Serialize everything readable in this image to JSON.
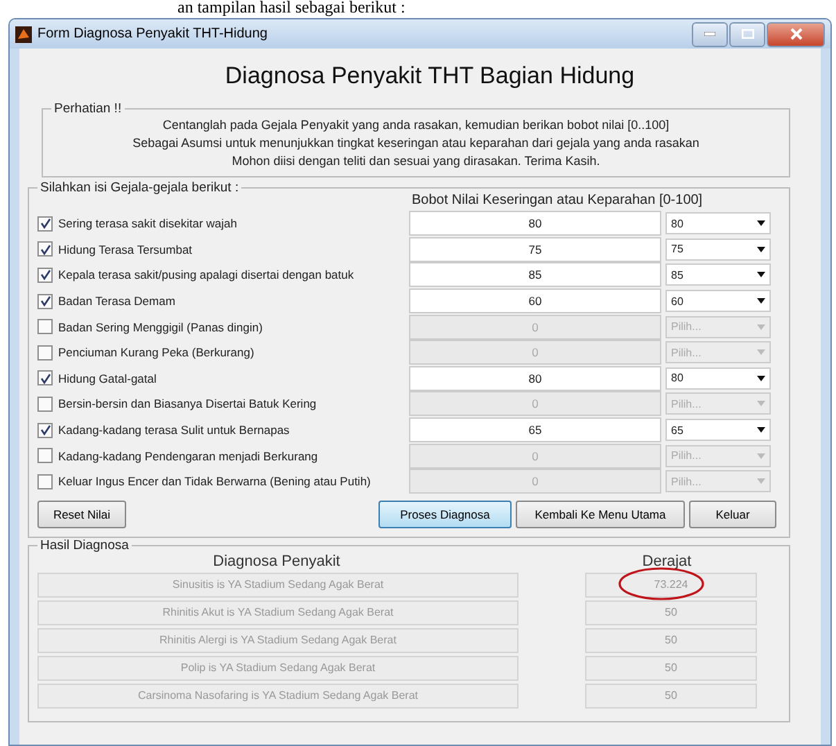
{
  "caption": "an tampilan hasil sebagai berikut :",
  "window": {
    "title": "Form Diagnosa Penyakit THT-Hidung"
  },
  "heading": "Diagnosa Penyakit THT Bagian Hidung",
  "notice": {
    "legend": "Perhatian !!",
    "lines": [
      "Centanglah pada Gejala Penyakit yang anda rasakan, kemudian berikan bobot nilai [0..100]",
      "Sebagai Asumsi untuk menunjukkan tingkat keseringan atau keparahan dari gejala yang anda rasakan",
      "Mohon diisi dengan teliti dan sesuai yang dirasakan. Terima Kasih."
    ]
  },
  "symptoms": {
    "legend": "Silahkan isi Gejala-gejala berikut :",
    "column_header": "Bobot Nilai Keseringan atau Keparahan [0-100]",
    "items": [
      {
        "label": "Sering terasa sakit disekitar wajah",
        "checked": true,
        "value": "80",
        "choice": "80"
      },
      {
        "label": "Hidung Terasa Tersumbat",
        "checked": true,
        "value": "75",
        "choice": "75"
      },
      {
        "label": "Kepala terasa sakit/pusing apalagi disertai dengan batuk",
        "checked": true,
        "value": "85",
        "choice": "85"
      },
      {
        "label": "Badan Terasa Demam",
        "checked": true,
        "value": "60",
        "choice": "60"
      },
      {
        "label": "Badan Sering Menggigil (Panas dingin)",
        "checked": false,
        "value": "0",
        "choice": "Pilih..."
      },
      {
        "label": "Penciuman Kurang Peka (Berkurang)",
        "checked": false,
        "value": "0",
        "choice": "Pilih..."
      },
      {
        "label": "Hidung Gatal-gatal",
        "checked": true,
        "value": "80",
        "choice": "80"
      },
      {
        "label": "Bersin-bersin dan Biasanya Disertai Batuk Kering",
        "checked": false,
        "value": "0",
        "choice": "Pilih..."
      },
      {
        "label": "Kadang-kadang terasa Sulit untuk Bernapas",
        "checked": true,
        "value": "65",
        "choice": "65"
      },
      {
        "label": "Kadang-kadang Pendengaran menjadi Berkurang",
        "checked": false,
        "value": "0",
        "choice": "Pilih..."
      },
      {
        "label": "Keluar Ingus Encer dan Tidak Berwarna (Bening atau Putih)",
        "checked": false,
        "value": "0",
        "choice": "Pilih..."
      }
    ]
  },
  "reset_button": "Reset Nilai",
  "buttons": [
    {
      "label": "Proses Diagnosa",
      "selected": true
    },
    {
      "label": "Kembali Ke Menu Utama",
      "selected": false
    },
    {
      "label": "Keluar",
      "selected": false
    }
  ],
  "results": {
    "legend": "Hasil Diagnosa",
    "headers": [
      "Diagnosa Penyakit",
      "Derajat"
    ],
    "rows": [
      {
        "diagnosis": "Sinusitis is YA Stadium Sedang Agak Berat",
        "degree": "73.224",
        "circled": true
      },
      {
        "diagnosis": "Rhinitis Akut is YA Stadium Sedang Agak Berat",
        "degree": "50",
        "circled": false
      },
      {
        "diagnosis": "Rhinitis Alergi is YA Stadium Sedang Agak Berat",
        "degree": "50",
        "circled": false
      },
      {
        "diagnosis": "Polip is YA Stadium Sedang Agak Berat",
        "degree": "50",
        "circled": false
      },
      {
        "diagnosis": "Carsinoma Nasofaring is YA Stadium Sedang Agak Berat",
        "degree": "50",
        "circled": false
      }
    ]
  }
}
